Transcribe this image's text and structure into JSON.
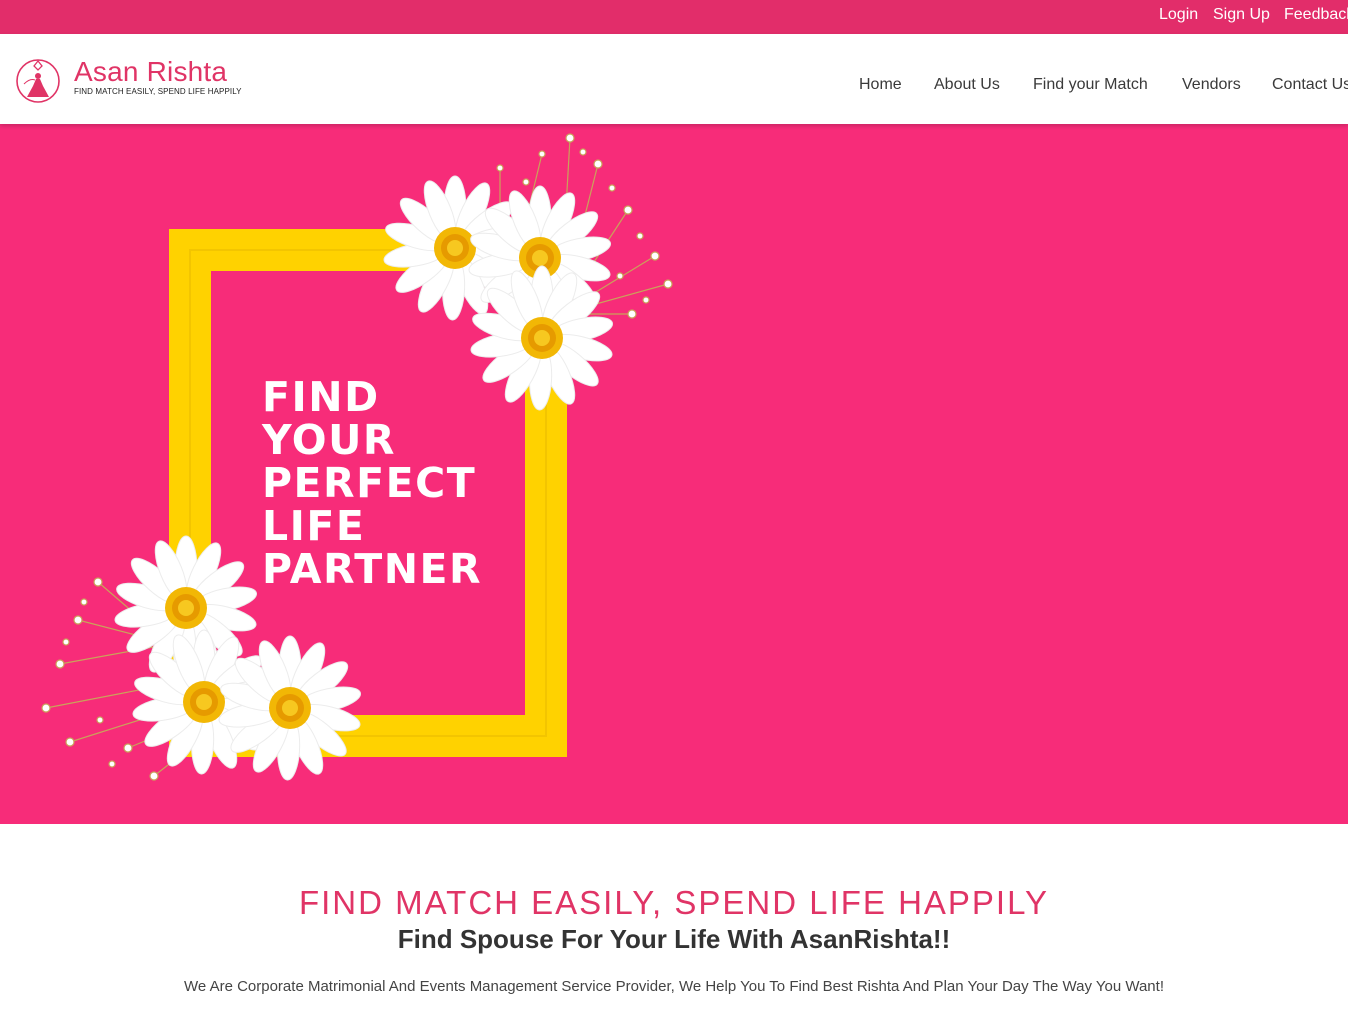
{
  "topbar": {
    "login": "Login",
    "signup": "Sign Up",
    "feedback": "Feedback"
  },
  "brand": {
    "name": "Asan Rishta",
    "tagline": "FIND MATCH EASILY, SPEND LIFE HAPPILY",
    "logo_icon": "bride-ring-icon"
  },
  "nav": {
    "home": "Home",
    "about": "About Us",
    "find_match": "Find your Match",
    "vendors": "Vendors",
    "contact": "Contact Us"
  },
  "hero": {
    "lines": [
      "FIND",
      "YOUR",
      "PERFECT",
      "LIFE",
      "PARTNER"
    ]
  },
  "intro": {
    "slogan": "FIND MATCH EASILY, SPEND LIFE HAPPILY",
    "heading": "Find Spouse For Your Life With AsanRishta!!",
    "description": "We Are Corporate Matrimonial And Events Management Service Provider, We Help You To Find Best Rishta And Plan Your Day The Way You Want!"
  },
  "colors": {
    "topbar": "#e22d6a",
    "brand": "#e03466",
    "hero_bg": "#f72c79",
    "frame": "#ffd200"
  }
}
